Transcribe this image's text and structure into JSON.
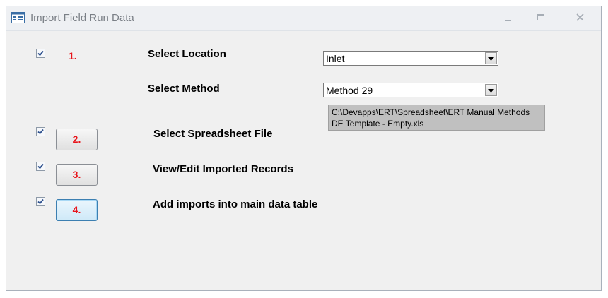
{
  "window": {
    "title": "Import Field Run Data",
    "icon": "form-icon",
    "controls": {
      "minimize": "minimize-icon",
      "maximize": "maximize-icon",
      "close": "close-icon"
    }
  },
  "steps": [
    {
      "number": "1.",
      "checked": true
    },
    {
      "number": "2.",
      "checked": true
    },
    {
      "number": "3.",
      "checked": true
    },
    {
      "number": "4.",
      "checked": true
    }
  ],
  "location": {
    "label": "Select Location",
    "value": "Inlet"
  },
  "method": {
    "label": "Select Method",
    "value": "Method 29"
  },
  "spreadsheet": {
    "label": "Select Spreadsheet File",
    "path": "C:\\Devapps\\ERT\\Spreadsheet\\ERT Manual Methods DE Template - Empty.xls"
  },
  "view_edit": {
    "label": "View/Edit Imported Records"
  },
  "add_imports": {
    "label": "Add imports into main data table"
  },
  "colors": {
    "step_number": "#e8131a",
    "checkmark": "#2b4e8c",
    "file_box": "#c0c0c0"
  }
}
